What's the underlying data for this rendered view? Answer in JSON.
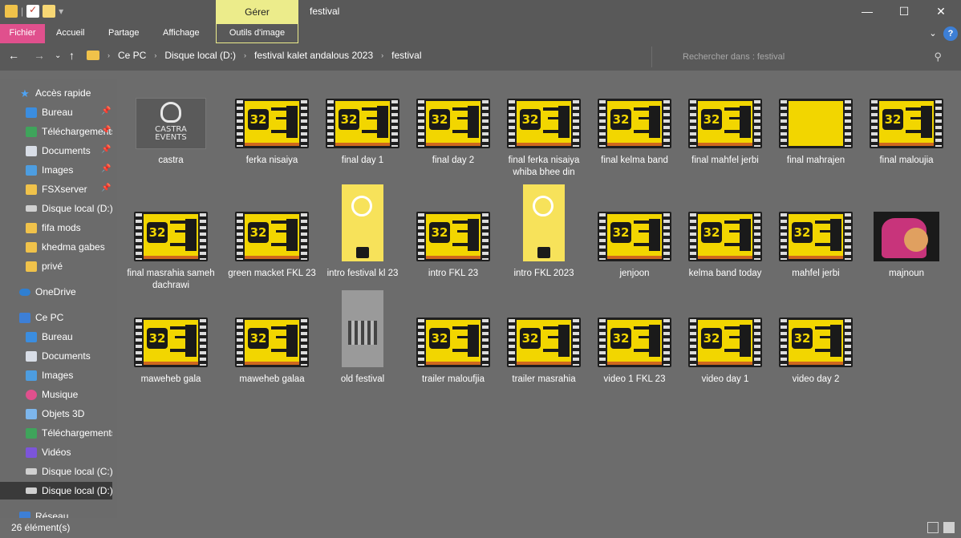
{
  "title_bar": {
    "window_title": "festival",
    "manage_label": "Gérer",
    "minimize": "—",
    "maximize": "☐",
    "close": "✕"
  },
  "ribbon": {
    "tabs": [
      "Fichier",
      "Accueil",
      "Partage",
      "Affichage",
      "Outils d'image"
    ],
    "expand": "⌄",
    "help": "?"
  },
  "address": {
    "crumbs": [
      "Ce PC",
      "Disque local (D:)",
      "festival kalet andalous 2023",
      "festival"
    ],
    "search_placeholder": "Rechercher dans : festival"
  },
  "sidebar": {
    "items": [
      {
        "label": "Accès rapide",
        "icon": "star-icon",
        "pinned": false
      },
      {
        "label": "Bureau",
        "icon": "desktop-icon",
        "pinned": true
      },
      {
        "label": "Téléchargements",
        "icon": "download-icon",
        "pinned": true
      },
      {
        "label": "Documents",
        "icon": "documents-icon",
        "pinned": true
      },
      {
        "label": "Images",
        "icon": "images-icon",
        "pinned": true
      },
      {
        "label": "FSXserver",
        "icon": "folder-icon",
        "pinned": true
      },
      {
        "label": "Disque local (D:)",
        "icon": "drive-icon",
        "pinned": false
      },
      {
        "label": "fifa mods",
        "icon": "folder-icon",
        "pinned": false
      },
      {
        "label": "khedma gabes",
        "icon": "folder-icon",
        "pinned": false
      },
      {
        "label": "privé",
        "icon": "folder-icon",
        "pinned": false
      },
      {
        "label": "OneDrive",
        "icon": "cloud-icon",
        "pinned": false
      },
      {
        "label": "Ce PC",
        "icon": "computer-icon",
        "pinned": false
      },
      {
        "label": "Bureau",
        "icon": "desktop-icon",
        "pinned": false
      },
      {
        "label": "Documents",
        "icon": "documents-icon",
        "pinned": false
      },
      {
        "label": "Images",
        "icon": "images-icon",
        "pinned": false
      },
      {
        "label": "Musique",
        "icon": "music-icon",
        "pinned": false
      },
      {
        "label": "Objets 3D",
        "icon": "objects-3d-icon",
        "pinned": false
      },
      {
        "label": "Téléchargements",
        "icon": "download-icon",
        "pinned": false
      },
      {
        "label": "Vidéos",
        "icon": "videos-icon",
        "pinned": false
      },
      {
        "label": "Disque local (C:)",
        "icon": "drive-icon",
        "pinned": false
      },
      {
        "label": "Disque local (D:)",
        "icon": "drive-icon",
        "pinned": false,
        "selected": true
      },
      {
        "label": "Réseau",
        "icon": "network-icon",
        "pinned": false
      }
    ]
  },
  "files": [
    {
      "name": "castra",
      "thumb": "logo"
    },
    {
      "name": "ferka nisaiya",
      "thumb": "video"
    },
    {
      "name": "final day 1",
      "thumb": "video"
    },
    {
      "name": "final day 2",
      "thumb": "video"
    },
    {
      "name": "final ferka nisaiya whiba bhee din",
      "thumb": "video"
    },
    {
      "name": "final kelma band",
      "thumb": "video"
    },
    {
      "name": "final mahfel jerbi",
      "thumb": "video"
    },
    {
      "name": "final mahrajen",
      "thumb": "video-plain"
    },
    {
      "name": "final maloujia",
      "thumb": "video"
    },
    {
      "name": "final masrahia sameh dachrawi",
      "thumb": "video"
    },
    {
      "name": "green macket FKL 23",
      "thumb": "video"
    },
    {
      "name": "intro festival kl 23",
      "thumb": "poster"
    },
    {
      "name": "intro FKL 23",
      "thumb": "video"
    },
    {
      "name": "intro FKL 2023",
      "thumb": "poster"
    },
    {
      "name": "jenjoon",
      "thumb": "video"
    },
    {
      "name": "kelma band today",
      "thumb": "video"
    },
    {
      "name": "mahfel jerbi",
      "thumb": "video"
    },
    {
      "name": "majnoun",
      "thumb": "photo"
    },
    {
      "name": "maweheb gala",
      "thumb": "video"
    },
    {
      "name": "maweheb galaa",
      "thumb": "video"
    },
    {
      "name": "old festival",
      "thumb": "old-photo"
    },
    {
      "name": "trailer maloufjia",
      "thumb": "video"
    },
    {
      "name": "trailer masrahia",
      "thumb": "video"
    },
    {
      "name": "video 1 FKL 23",
      "thumb": "video"
    },
    {
      "name": "video day 1",
      "thumb": "video"
    },
    {
      "name": "video day 2",
      "thumb": "video"
    }
  ],
  "thumb_text": {
    "number": "32",
    "castra_line1": "CASTRA",
    "castra_line2": "EVENTS"
  },
  "status": {
    "count": "26 élément(s)"
  },
  "colors": {
    "accent_file_tab": "#e0508d",
    "manage_tab": "#ecec8b",
    "poster_yellow": "#f2d600"
  }
}
